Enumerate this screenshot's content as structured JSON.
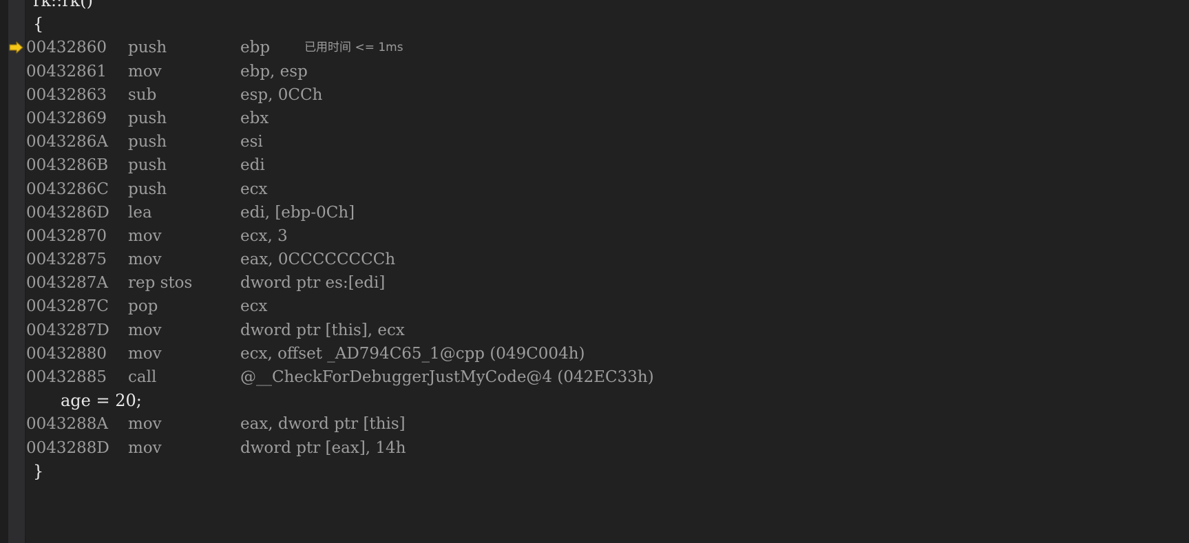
{
  "window": {
    "view_name": "Disassembly",
    "background_color": "#1e1e1e",
    "code_background_color": "#212121",
    "gutter_color": "#2d2d30",
    "source_text_color": "#e8e8e8",
    "asm_text_color": "#9d9d9d",
    "arrow_color": "#f5c518"
  },
  "gutter": {
    "instruction_pointer_icon": "right-arrow-icon",
    "instruction_pointer_line_index": 2
  },
  "lines": [
    {
      "kind": "source",
      "indent": 1,
      "text": "rk::rk()"
    },
    {
      "kind": "source",
      "indent": 1,
      "text": "{"
    },
    {
      "kind": "asm",
      "address": "00432860",
      "mnemonic": "push",
      "operands": "ebp",
      "note": "已用时间 <= 1ms",
      "current": true
    },
    {
      "kind": "asm",
      "address": "00432861",
      "mnemonic": "mov",
      "operands": "ebp, esp",
      "note": ""
    },
    {
      "kind": "asm",
      "address": "00432863",
      "mnemonic": "sub",
      "operands": "esp, 0CCh",
      "note": ""
    },
    {
      "kind": "asm",
      "address": "00432869",
      "mnemonic": "push",
      "operands": "ebx",
      "note": ""
    },
    {
      "kind": "asm",
      "address": "0043286A",
      "mnemonic": "push",
      "operands": "esi",
      "note": ""
    },
    {
      "kind": "asm",
      "address": "0043286B",
      "mnemonic": "push",
      "operands": "edi",
      "note": ""
    },
    {
      "kind": "asm",
      "address": "0043286C",
      "mnemonic": "push",
      "operands": "ecx",
      "note": ""
    },
    {
      "kind": "asm",
      "address": "0043286D",
      "mnemonic": "lea",
      "operands": "edi, [ebp-0Ch]",
      "note": ""
    },
    {
      "kind": "asm",
      "address": "00432870",
      "mnemonic": "mov",
      "operands": "ecx, 3",
      "note": ""
    },
    {
      "kind": "asm",
      "address": "00432875",
      "mnemonic": "mov",
      "operands": "eax, 0CCCCCCCCh",
      "note": ""
    },
    {
      "kind": "asm",
      "address": "0043287A",
      "mnemonic": "rep stos",
      "operands": "dword ptr es:[edi]",
      "note": ""
    },
    {
      "kind": "asm",
      "address": "0043287C",
      "mnemonic": "pop",
      "operands": "ecx",
      "note": ""
    },
    {
      "kind": "asm",
      "address": "0043287D",
      "mnemonic": "mov",
      "operands": "dword ptr [this], ecx",
      "note": ""
    },
    {
      "kind": "asm",
      "address": "00432880",
      "mnemonic": "mov",
      "operands": "ecx, offset _AD794C65_1@cpp (049C004h)",
      "note": ""
    },
    {
      "kind": "asm",
      "address": "00432885",
      "mnemonic": "call",
      "operands": "@__CheckForDebuggerJustMyCode@4 (042EC33h)",
      "note": ""
    },
    {
      "kind": "source",
      "indent": 2,
      "text": "age = 20;"
    },
    {
      "kind": "asm",
      "address": "0043288A",
      "mnemonic": "mov",
      "operands": "eax, dword ptr [this]",
      "note": ""
    },
    {
      "kind": "asm",
      "address": "0043288D",
      "mnemonic": "mov",
      "operands": "dword ptr [eax], 14h",
      "note": ""
    },
    {
      "kind": "source",
      "indent": 1,
      "text": "}"
    }
  ]
}
